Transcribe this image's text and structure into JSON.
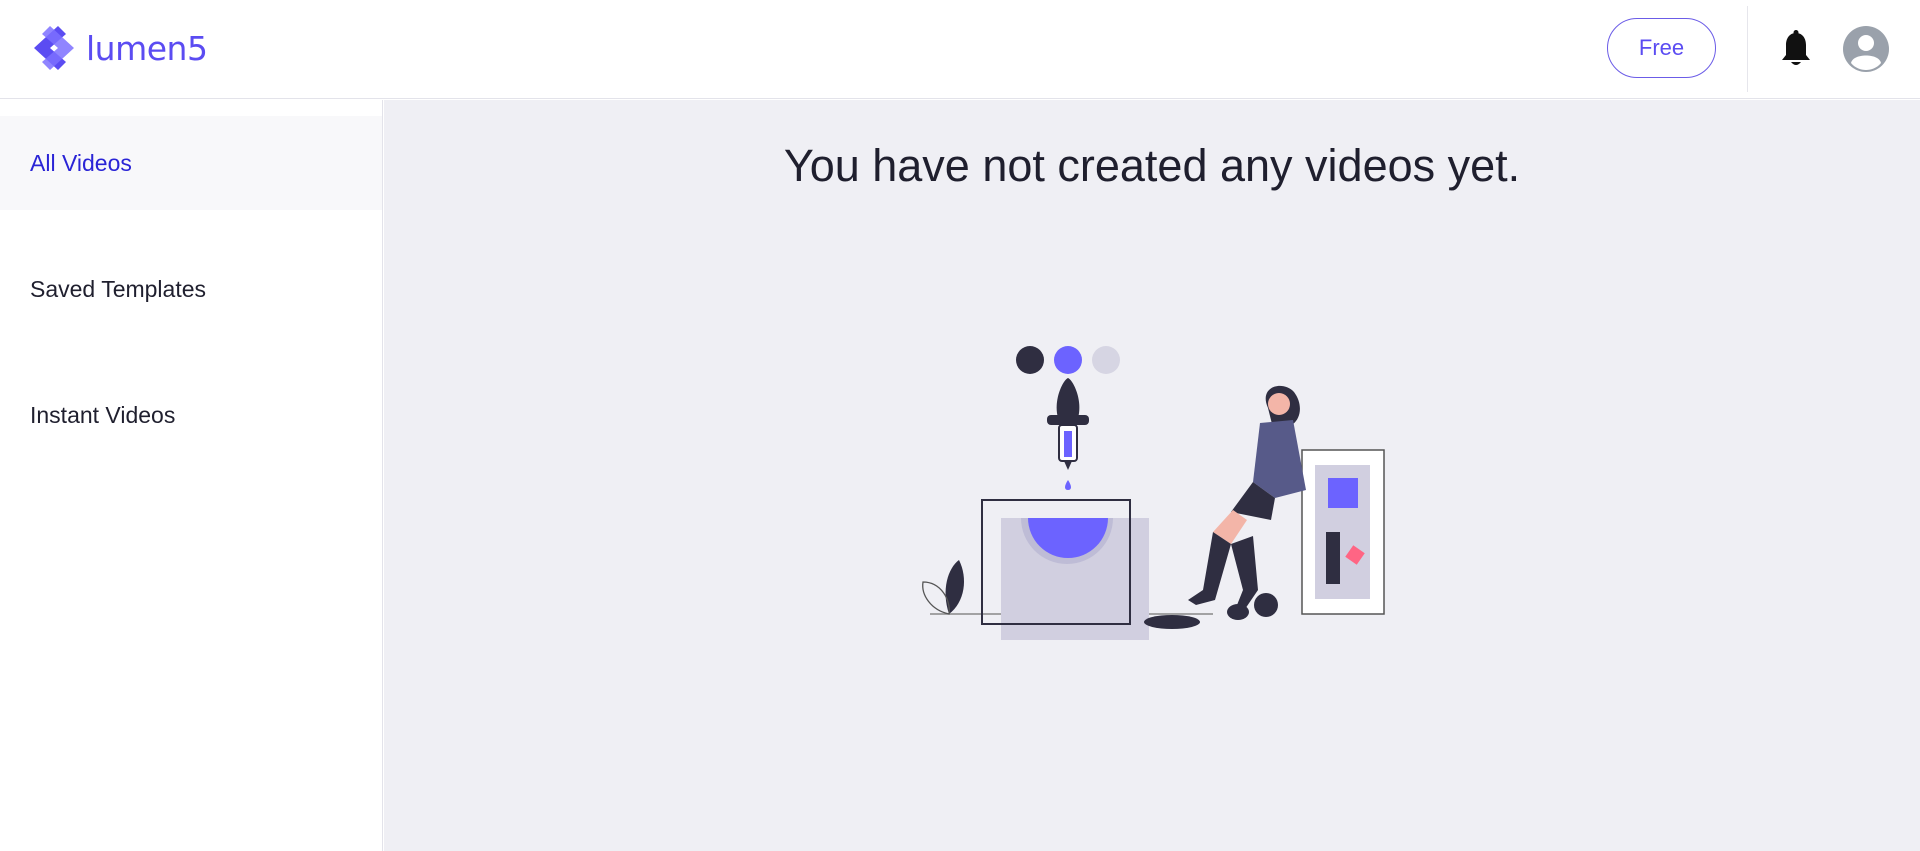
{
  "brand": {
    "name": "lumen5",
    "color": "#5b4cf2"
  },
  "header": {
    "plan_label": "Free",
    "icons": [
      "lumen5-logo-icon",
      "bell-icon",
      "user-avatar-icon"
    ]
  },
  "sidebar": {
    "items": [
      {
        "label": "All Videos",
        "active": true
      },
      {
        "label": "Saved Templates",
        "active": false
      },
      {
        "label": "Instant Videos",
        "active": false
      }
    ]
  },
  "main": {
    "empty_message": "You have not created any videos yet."
  },
  "colors": {
    "accent": "#6c63ff",
    "dark": "#2f2e41",
    "background": "#efeff4",
    "active_nav": "#2a24d6",
    "pink": "#ff6584"
  }
}
